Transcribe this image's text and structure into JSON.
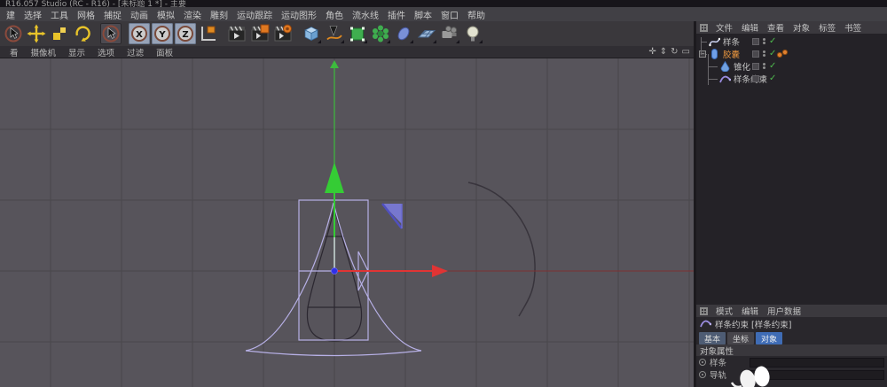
{
  "window": {
    "title": "R16.057 Studio (RC - R16) - [未标题 1 *] - 主要"
  },
  "main_menu": {
    "items": [
      "建",
      "选择",
      "工具",
      "网格",
      "捕捉",
      "动画",
      "模拟",
      "渲染",
      "雕刻",
      "运动跟踪",
      "运动图形",
      "角色",
      "流水线",
      "插件",
      "脚本",
      "窗口",
      "帮助"
    ]
  },
  "toolbar": {
    "tools": [
      {
        "name": "live-selection-tool",
        "icon": "cursor"
      },
      {
        "name": "move-tool",
        "icon": "move"
      },
      {
        "name": "scale-tool",
        "icon": "scale"
      },
      {
        "name": "rotate-tool",
        "icon": "rotate"
      },
      {
        "name": "last-used-tool",
        "icon": "cursor",
        "pressed": true,
        "gap": true
      },
      {
        "name": "lock-x-axis",
        "icon": "axis",
        "label": "X",
        "active": true,
        "gap": true
      },
      {
        "name": "lock-y-axis",
        "icon": "axis",
        "label": "Y",
        "active": true
      },
      {
        "name": "lock-z-axis",
        "icon": "axis",
        "label": "Z",
        "active": true
      },
      {
        "name": "coordinate-system",
        "icon": "coord"
      },
      {
        "name": "render-view",
        "icon": "clapper",
        "gap": true
      },
      {
        "name": "render-picture-viewer",
        "icon": "clapper-pv"
      },
      {
        "name": "render-settings",
        "icon": "clapper-rs"
      },
      {
        "name": "add-primitive-cube",
        "icon": "cube",
        "gap": true,
        "flyout": true
      },
      {
        "name": "spline-pen",
        "icon": "pen",
        "flyout": true
      },
      {
        "name": "add-generator",
        "icon": "cage",
        "flyout": true
      },
      {
        "name": "add-deformer",
        "icon": "flower",
        "flyout": true
      },
      {
        "name": "add-modeling-object",
        "icon": "blob",
        "flyout": true
      },
      {
        "name": "add-environment-floor",
        "icon": "floor",
        "flyout": true
      },
      {
        "name": "add-camera",
        "icon": "camera",
        "flyout": true
      },
      {
        "name": "add-light",
        "icon": "light",
        "flyout": true
      }
    ]
  },
  "viewport": {
    "menu_items": [
      "看",
      "摄像机",
      "显示",
      "选项",
      "过滤",
      "面板"
    ],
    "corner_icons": [
      "pan-view-icon",
      "zoom-view-icon",
      "rotate-view-icon",
      "toggle-panel-icon"
    ],
    "background": "#57545b",
    "grid_color": "#48464b",
    "axis_colors": {
      "x": "#e03434",
      "x_far": "#7e3030",
      "y": "#35cc35",
      "origin_dot": "#3030e8"
    },
    "object_outline_color": "#b7b0e6",
    "dark_outline_color": "#2b2730"
  },
  "object_manager": {
    "menu_items": [
      "文件",
      "编辑",
      "查看",
      "对象",
      "标签",
      "书签"
    ],
    "objects": [
      {
        "label": "样条",
        "icon": "spline-icon",
        "depth": 0,
        "selected": false,
        "expander": false,
        "tag": false
      },
      {
        "label": "胶囊",
        "icon": "capsule-icon",
        "depth": 0,
        "selected": true,
        "expander": true,
        "tag": true
      },
      {
        "label": "锥化",
        "icon": "taper-icon",
        "depth": 1,
        "selected": false,
        "expander": false,
        "tag": false
      },
      {
        "label": "样条约束",
        "icon": "spline-wrap-icon",
        "depth": 1,
        "selected": false,
        "expander": false,
        "tag": false
      }
    ],
    "selected_color": "#e8953f",
    "enabled_check": "✓"
  },
  "attributes": {
    "menu_items": [
      "模式",
      "编辑",
      "用户数据"
    ],
    "object_title": "样条约束 [样条约束]",
    "tabs": [
      {
        "label": "基本",
        "state": "secondary"
      },
      {
        "label": "坐标",
        "state": "normal"
      },
      {
        "label": "对象",
        "state": "active"
      }
    ],
    "section": "对象属性",
    "rows": [
      {
        "label": "样条",
        "value": ""
      },
      {
        "label": "导轨",
        "value": ""
      }
    ],
    "active_tab_color": "#3f6cb5"
  }
}
